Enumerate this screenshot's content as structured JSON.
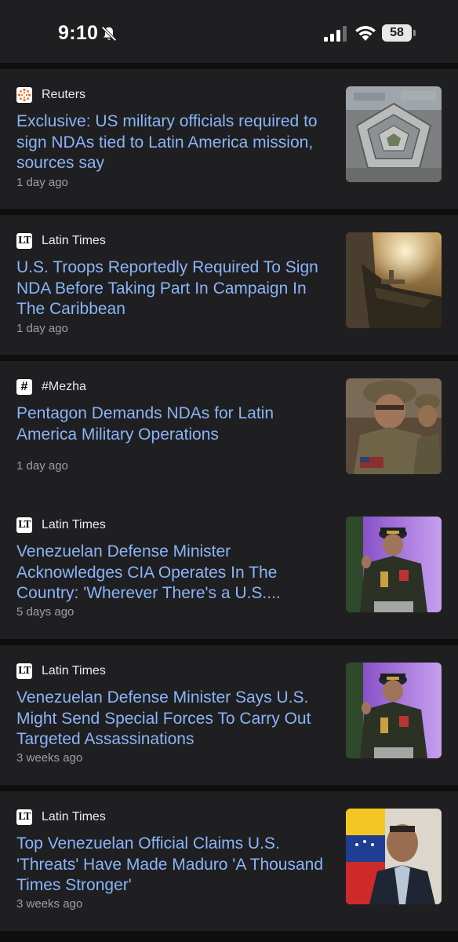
{
  "status_bar": {
    "time": "9:10",
    "battery": "58",
    "icons": [
      "bell-off-icon",
      "cellular-signal-icon",
      "wifi-icon",
      "battery-icon"
    ]
  },
  "articles": [
    {
      "source": "Reuters",
      "source_logo": "reuters-logo-icon",
      "headline": "Exclusive: US military officials required to sign NDAs tied to Latin America mission, sources say",
      "time": "1 day ago",
      "thumbnail": "pentagon-aerial-photo"
    },
    {
      "source": "Latin Times",
      "source_logo": "latin-times-logo-icon",
      "headline": "U.S. Troops Reportedly Required To Sign NDA Before Taking Part In Campaign In The Caribbean",
      "time": "1 day ago",
      "thumbnail": "warship-at-sea-photo"
    },
    {
      "source": "#Mezha",
      "source_logo": "mezha-hash-logo-icon",
      "headline": "Pentagon Demands NDAs for Latin America Military Operations",
      "time": "1 day ago",
      "thumbnail": "soldiers-photo"
    },
    {
      "source": "Latin Times",
      "source_logo": "latin-times-logo-icon",
      "headline": "Venezuelan Defense Minister Acknowledges CIA Operates In The Country: 'Wherever There's a U.S....",
      "time": "5 days ago",
      "thumbnail": "defense-minister-speaking-photo"
    },
    {
      "source": "Latin Times",
      "source_logo": "latin-times-logo-icon",
      "headline": "Venezuelan Defense Minister Says U.S. Might Send Special Forces To Carry Out Targeted Assassinations",
      "time": "3 weeks ago",
      "thumbnail": "defense-minister-speaking-photo"
    },
    {
      "source": "Latin Times",
      "source_logo": "latin-times-logo-icon",
      "headline": "Top Venezuelan Official Claims U.S. 'Threats' Have Made Maduro 'A Thousand Times Stronger'",
      "time": "3 weeks ago",
      "thumbnail": "official-with-flag-photo"
    }
  ]
}
